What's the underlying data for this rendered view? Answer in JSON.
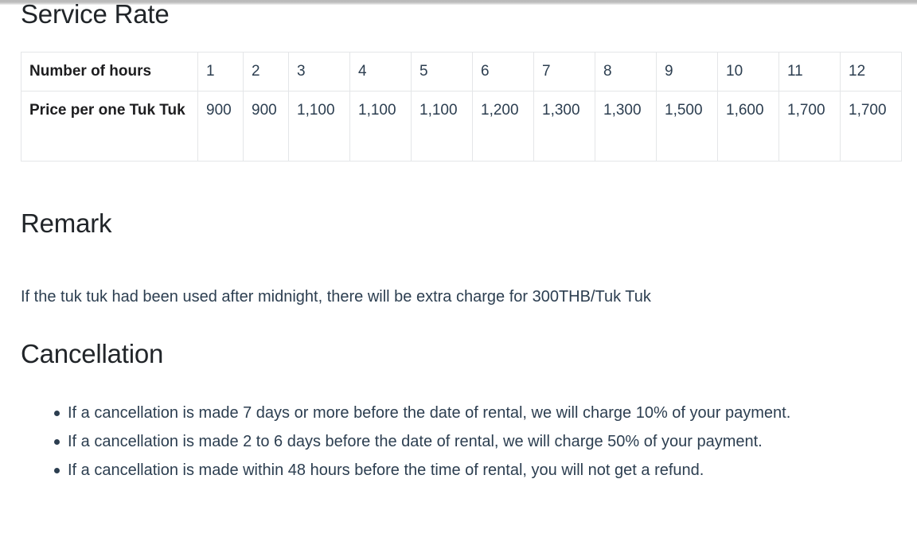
{
  "document": {
    "sections": {
      "service_rate": {
        "heading": "Service Rate",
        "table": {
          "row_hours_label": "Number of hours",
          "hours": [
            "1",
            "2",
            "3",
            "4",
            "5",
            "6",
            "7",
            "8",
            "9",
            "10",
            "11",
            "12"
          ],
          "row_price_label": "Price per one Tuk Tuk",
          "prices": [
            "900",
            "900",
            "1,100",
            "1,100",
            "1,100",
            "1,200",
            "1,300",
            "1,300",
            "1,500",
            "1,600",
            "1,700",
            "1,700"
          ]
        }
      },
      "remark": {
        "heading": "Remark",
        "text": "If the tuk tuk had been used after midnight, there will be extra charge for 300THB/Tuk Tuk"
      },
      "cancellation": {
        "heading": "Cancellation",
        "items": [
          "If a cancellation is made 7 days or more before the date of rental, we will charge 10% of your payment.",
          "If a cancellation is made 2 to 6 days before the date of rental, we will charge 50% of your payment.",
          "If a cancellation is made within 48 hours before the time of rental, you will not get a refund."
        ]
      }
    }
  },
  "colors": {
    "heading": "#212529",
    "body_text": "#2c3e50",
    "table_border": "#e4e6e8",
    "background": "#ffffff",
    "top_strip": "#bdbdbd"
  }
}
